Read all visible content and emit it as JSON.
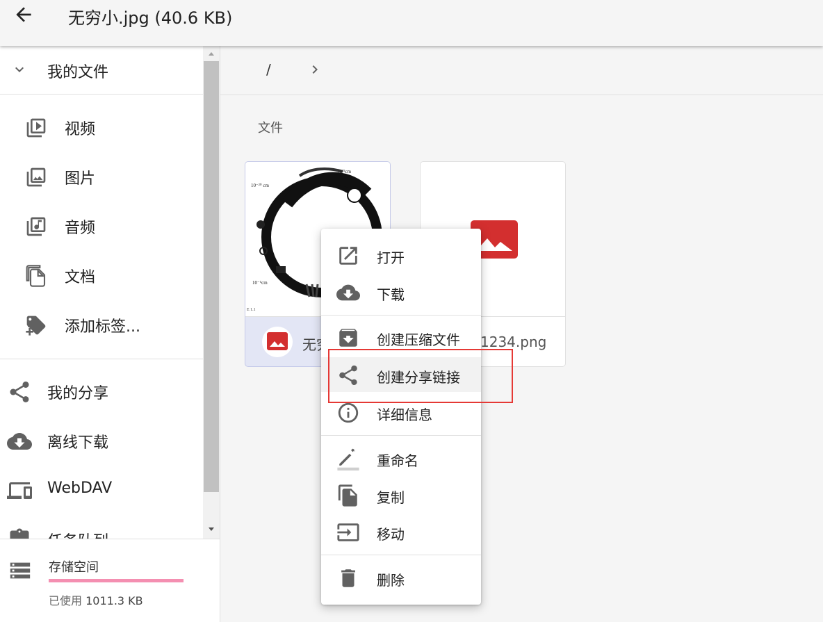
{
  "header": {
    "title": "无穷小.jpg (40.6 KB)"
  },
  "sidebar": {
    "section_title": "我的文件",
    "items": [
      {
        "label": "视频",
        "icon": "video-library-icon"
      },
      {
        "label": "图片",
        "icon": "photo-library-icon"
      },
      {
        "label": "音频",
        "icon": "library-music-icon"
      },
      {
        "label": "文档",
        "icon": "file-copy-icon"
      },
      {
        "label": "添加标签...",
        "icon": "tag-plus-icon"
      }
    ],
    "items2": [
      {
        "label": "我的分享",
        "icon": "share-icon"
      },
      {
        "label": "离线下载",
        "icon": "cloud-download-icon"
      },
      {
        "label": "WebDAV",
        "icon": "devices-icon"
      },
      {
        "label": "任务队列",
        "icon": "clipboard-icon"
      }
    ]
  },
  "storage": {
    "label": "存储空间",
    "used_prefix": "已使用",
    "used_value": "1011.3 KB",
    "usage_fraction": 1.0
  },
  "breadcrumb": {
    "root": "/"
  },
  "main": {
    "section_label": "文件",
    "files": [
      {
        "name": "无穷小.jpg",
        "visible_name": "无穷",
        "selected": true
      },
      {
        "name": "1234.png",
        "visible_name": "1234.png",
        "selected": false
      }
    ]
  },
  "context_menu": {
    "items": [
      {
        "label": "打开",
        "icon": "open-in-new-icon"
      },
      {
        "label": "下载",
        "icon": "cloud-download-icon"
      },
      {
        "label": "创建压缩文件",
        "icon": "archive-icon"
      },
      {
        "label": "创建分享链接",
        "icon": "share-icon",
        "highlighted": true
      },
      {
        "label": "详细信息",
        "icon": "info-icon"
      },
      {
        "label": "重命名",
        "icon": "edit-pencil-icon"
      },
      {
        "label": "复制",
        "icon": "file-copy-icon"
      },
      {
        "label": "移动",
        "icon": "move-input-icon"
      },
      {
        "label": "删除",
        "icon": "delete-icon"
      }
    ]
  },
  "colors": {
    "accent_red": "#e53935",
    "image_icon_red": "#d32f2f",
    "selected_card": "#e3e6f5",
    "storage_bar": "#f48fb1",
    "icon_grey": "#616161"
  }
}
